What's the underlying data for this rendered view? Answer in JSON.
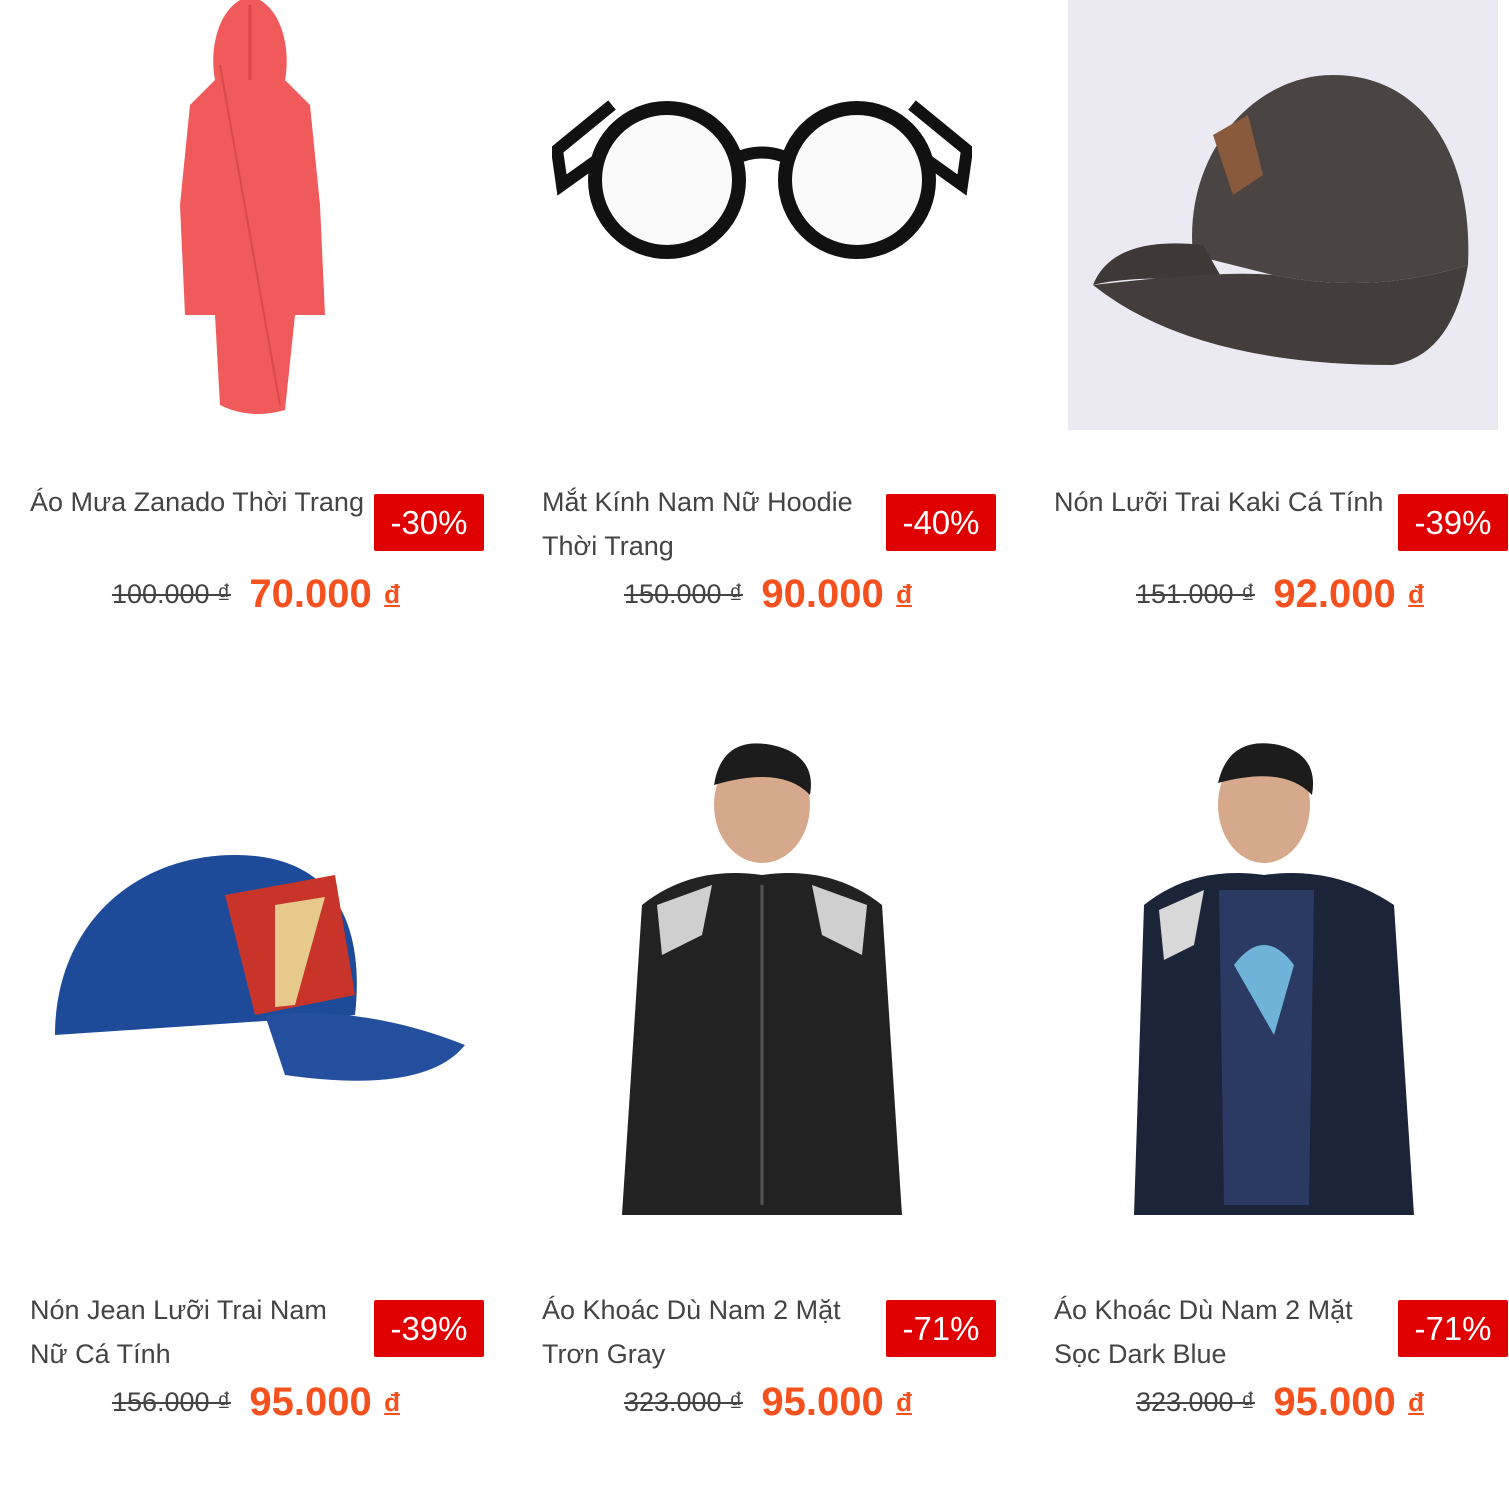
{
  "products": [
    {
      "name": "Áo Mưa Zanado Thời Trang",
      "discount": "-30%",
      "old_price": "100.000 ₫",
      "new_price": "70.000",
      "currency": "đ",
      "image": "red-raincoat"
    },
    {
      "name": "Mắt Kính Nam Nữ Hoodie Thời Trang",
      "discount": "-40%",
      "old_price": "150.000 ₫",
      "new_price": "90.000",
      "currency": "đ",
      "image": "black-glasses"
    },
    {
      "name": "Nón Lưỡi Trai Kaki Cá Tính",
      "discount": "-39%",
      "old_price": "151.000 ₫",
      "new_price": "92.000",
      "currency": "đ",
      "image": "brown-cap"
    },
    {
      "name": "Nón Jean Lưỡi Trai Nam Nữ Cá Tính",
      "discount": "-39%",
      "old_price": "156.000 ₫",
      "new_price": "95.000",
      "currency": "đ",
      "image": "denim-cap"
    },
    {
      "name": "Áo Khoác Dù Nam 2 Mặt Trơn Gray",
      "discount": "-71%",
      "old_price": "323.000 ₫",
      "new_price": "95.000",
      "currency": "đ",
      "image": "black-jacket"
    },
    {
      "name": "Áo Khoác Dù Nam 2 Mặt Sọc Dark Blue",
      "discount": "-71%",
      "old_price": "323.000 ₫",
      "new_price": "95.000",
      "currency": "đ",
      "image": "navy-jacket"
    }
  ],
  "colors": {
    "badge": "#e10000",
    "price": "#f4511e"
  }
}
